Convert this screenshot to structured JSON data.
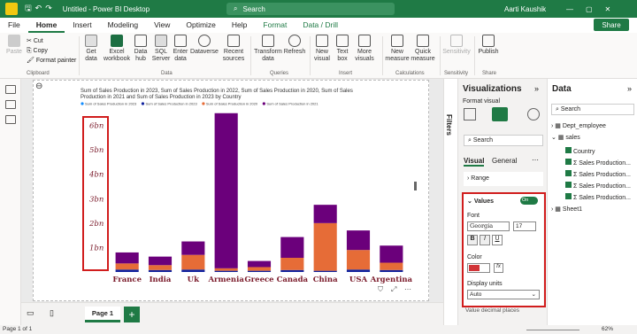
{
  "titlebar": {
    "doc_title": "Untitled - Power BI Desktop",
    "search": "Search",
    "user": "Aarti Kaushik"
  },
  "tabs": [
    "File",
    "Home",
    "Insert",
    "Modeling",
    "View",
    "Optimize",
    "Help",
    "Format",
    "Data / Drill"
  ],
  "share_label": "Share",
  "ribbon": {
    "clipboard": {
      "paste": "Paste",
      "cut": "Cut",
      "copy": "Copy",
      "format_painter": "Format painter",
      "group": "Clipboard"
    },
    "data": {
      "get_data": "Get data",
      "excel": "Excel workbook",
      "hub": "Data hub",
      "sql": "SQL Server",
      "enter": "Enter data",
      "dataverse": "Dataverse",
      "recent": "Recent sources",
      "group": "Data"
    },
    "queries": {
      "transform": "Transform data",
      "refresh": "Refresh",
      "group": "Queries"
    },
    "insert": {
      "new_visual": "New visual",
      "text_box": "Text box",
      "more_visuals": "More visuals",
      "group": "Insert"
    },
    "calculations": {
      "new_measure": "New measure",
      "quick_measure": "Quick measure",
      "group": "Calculations"
    },
    "sensitivity": {
      "label": "Sensitivity",
      "group": "Sensitivity"
    },
    "share": {
      "publish": "Publish",
      "group": "Share"
    }
  },
  "page_tab": "Page 1",
  "status": {
    "page": "Page 1 of 1",
    "zoom": "62%"
  },
  "filters_label": "Filters",
  "viz_pane": {
    "title": "Visualizations",
    "format_visual": "Format visual",
    "search": "Search",
    "tabs": [
      "Visual",
      "General"
    ],
    "range": "Range",
    "values": "Values",
    "toggle": "On",
    "font_label": "Font",
    "font": "Georgia",
    "font_size": "17",
    "bold": "B",
    "italic": "I",
    "underline": "U",
    "color_label": "Color",
    "fx": "fx",
    "display_units_label": "Display units",
    "display_units": "Auto",
    "decimal_places": "Value decimal places"
  },
  "data_pane": {
    "title": "Data",
    "search": "Search",
    "tables": [
      "Dept_employee",
      "sales",
      "Sheet1"
    ],
    "fields": [
      "Country",
      "Sales Production...",
      "Sales Production...",
      "Sales Production...",
      "Sales Production..."
    ]
  },
  "chart_data": {
    "type": "bar",
    "title": "Sum of Sales Production in 2023, Sum of Sales Production in 2022, Sum of Sales Production in 2020, Sum of Sales Production in 2021 and Sum of Sales Production in 2023 by Country",
    "categories": [
      "France",
      "India",
      "Uk",
      "Armenia",
      "Greece",
      "Canada",
      "China",
      "USA",
      "Argentina"
    ],
    "legend": [
      "Sum of Sales Production in 2023",
      "Sum of Sales Production in 2023",
      "Sum of Sales Production in 2020",
      "Sum of Sales Production in 2021"
    ],
    "series": [
      {
        "name": "Sum of Sales Production in 2023",
        "color": "#12239e",
        "values": [
          0.1,
          0.08,
          0.1,
          0.05,
          0.05,
          0.08,
          0.05,
          0.1,
          0.08
        ]
      },
      {
        "name": "Sum of Sales Production in 2023",
        "color": "#e66c37",
        "values": [
          0.25,
          0.2,
          0.6,
          0.1,
          0.15,
          0.5,
          1.95,
          0.8,
          0.3
        ]
      },
      {
        "name": "Sum of Sales Production in 2021",
        "color": "#6b007b",
        "values": [
          0.45,
          0.35,
          0.55,
          6.35,
          0.25,
          0.85,
          0.75,
          0.8,
          0.7
        ]
      }
    ],
    "y_ticks": [
      "1bn",
      "2bn",
      "3bn",
      "4bn",
      "5bn",
      "6bn"
    ],
    "ylim": [
      0,
      6.6
    ],
    "colors": {
      "label": "#7a1a2a",
      "highlight": "#d11d1d"
    }
  }
}
